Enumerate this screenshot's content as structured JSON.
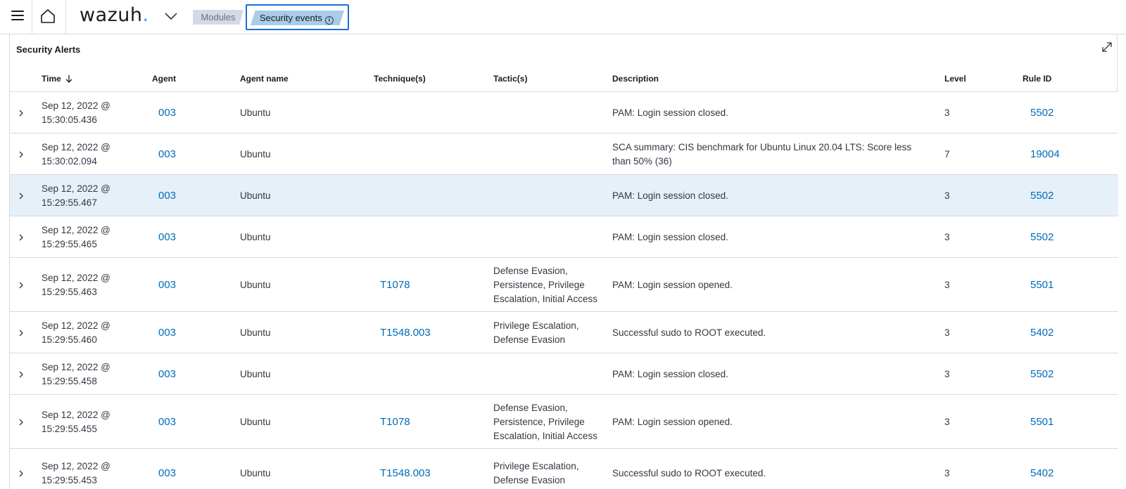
{
  "header": {
    "logo_text": "wazuh",
    "logo_dot": ".",
    "breadcrumbs": [
      "Modules",
      "Security events"
    ],
    "accent_color": "#3595f9"
  },
  "panel": {
    "title": "Security Alerts",
    "columns": [
      "Time",
      "Agent",
      "Agent name",
      "Technique(s)",
      "Tactic(s)",
      "Description",
      "Level",
      "Rule ID"
    ]
  },
  "rows": [
    {
      "date": "Sep 12, 2022 @",
      "time": "15:30:05.436",
      "agent": "003",
      "agent_name": "Ubuntu",
      "technique": "",
      "tactic": [],
      "description": "PAM: Login session closed.",
      "level": "3",
      "rule_id": "5502"
    },
    {
      "date": "Sep 12, 2022 @",
      "time": "15:30:02.094",
      "agent": "003",
      "agent_name": "Ubuntu",
      "technique": "",
      "tactic": [],
      "description": "SCA summary: CIS benchmark for Ubuntu Linux 20.04 LTS: Score less than 50% (36)",
      "level": "7",
      "rule_id": "19004"
    },
    {
      "date": "Sep 12, 2022 @",
      "time": "15:29:55.467",
      "agent": "003",
      "agent_name": "Ubuntu",
      "technique": "",
      "tactic": [],
      "description": "PAM: Login session closed.",
      "level": "3",
      "rule_id": "5502",
      "highlight": true
    },
    {
      "date": "Sep 12, 2022 @",
      "time": "15:29:55.465",
      "agent": "003",
      "agent_name": "Ubuntu",
      "technique": "",
      "tactic": [],
      "description": "PAM: Login session closed.",
      "level": "3",
      "rule_id": "5502"
    },
    {
      "date": "Sep 12, 2022 @",
      "time": "15:29:55.463",
      "agent": "003",
      "agent_name": "Ubuntu",
      "technique": "T1078",
      "tactic": [
        "Defense Evasion,",
        "Persistence, Privilege",
        "Escalation, Initial Access"
      ],
      "description": "PAM: Login session opened.",
      "level": "3",
      "rule_id": "5501"
    },
    {
      "date": "Sep 12, 2022 @",
      "time": "15:29:55.460",
      "agent": "003",
      "agent_name": "Ubuntu",
      "technique": "T1548.003",
      "tactic": [
        "Privilege Escalation,",
        "Defense Evasion"
      ],
      "description": "Successful sudo to ROOT executed.",
      "level": "3",
      "rule_id": "5402"
    },
    {
      "date": "Sep 12, 2022 @",
      "time": "15:29:55.458",
      "agent": "003",
      "agent_name": "Ubuntu",
      "technique": "",
      "tactic": [],
      "description": "PAM: Login session closed.",
      "level": "3",
      "rule_id": "5502"
    },
    {
      "date": "Sep 12, 2022 @",
      "time": "15:29:55.455",
      "agent": "003",
      "agent_name": "Ubuntu",
      "technique": "T1078",
      "tactic": [
        "Defense Evasion,",
        "Persistence, Privilege",
        "Escalation, Initial Access"
      ],
      "description": "PAM: Login session opened.",
      "level": "3",
      "rule_id": "5501"
    },
    {
      "date": "Sep 12, 2022 @",
      "time": "15:29:55.453",
      "agent": "003",
      "agent_name": "Ubuntu",
      "technique": "T1548.003",
      "tactic": [
        "Privilege Escalation,",
        "Defense Evasion"
      ],
      "description": "Successful sudo to ROOT executed.",
      "level": "3",
      "rule_id": "5402"
    }
  ]
}
